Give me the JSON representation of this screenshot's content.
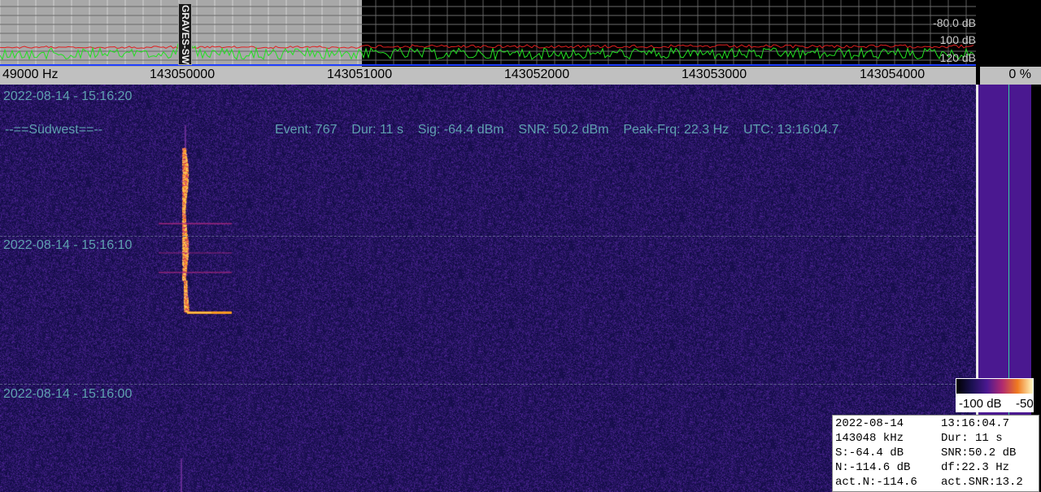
{
  "spectrum": {
    "db_labels": [
      "-80.0 dB",
      "100 dB",
      "120 dB"
    ],
    "beacon_label": "GRAVES-SW"
  },
  "freq_axis": {
    "labels": [
      "49000 Hz",
      "143050000",
      "143051000",
      "143052000",
      "143053000",
      "143054000"
    ],
    "percent": "0 %"
  },
  "waterfall": {
    "timestamps": [
      "2022-08-14 - 15:16:20",
      "2022-08-14 - 15:16:10",
      "2022-08-14 - 15:16:00"
    ],
    "station": "--==Südwest==--",
    "event_line": "Event: 767    Dur: 11 s    Sig: -64.4 dBm    SNR: 50.2 dBm    Peak-Frq: 22.3 Hz    UTC: 13:16:04.7"
  },
  "scale": {
    "low": "-100 dB",
    "high": "-50"
  },
  "info": {
    "rows": [
      [
        "2022-08-14",
        "13:16:04.7"
      ],
      [
        "143048 kHz",
        "Dur: 11 s"
      ],
      [
        "S:-64.4 dB",
        "SNR:50.2 dB"
      ],
      [
        "N:-114.6 dB",
        "df:22.3 Hz"
      ],
      [
        "act.N:-114.6",
        "act.SNR:13.2"
      ]
    ]
  },
  "colors": {
    "spectrum_green": "#22e022",
    "spectrum_red": "#e02020",
    "waterfall_bg": "#1a1250",
    "signal_hot": "#ffb020",
    "overlay_text": "#5fa0b0"
  }
}
